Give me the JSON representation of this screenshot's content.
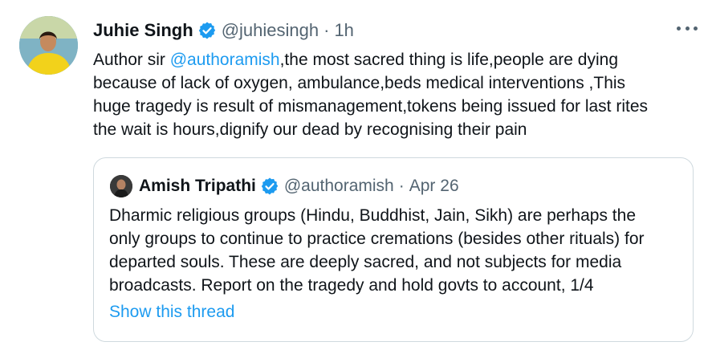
{
  "tweet": {
    "author_name": "Juhie Singh",
    "author_handle": "@juhiesingh",
    "separator": "·",
    "time": "1h",
    "more_label": "More",
    "text_lines": {
      "l1_prefix": "Author sir ",
      "l1_mention": "@authoramish",
      "l1_suffix": ",the most sacred thing is life,people are dying",
      "l2": "because of lack of oxygen, ambulance,beds medical interventions ,This",
      "l3": "huge tragedy is result of mismanagement,tokens  being issued for last rites",
      "l4": "the wait is hours,dignify our dead by recognising their pain"
    }
  },
  "quote": {
    "author_name": "Amish Tripathi",
    "author_handle": "@authoramish",
    "separator": "·",
    "date": "Apr 26",
    "text_lines": {
      "l1": "Dharmic religious groups (Hindu, Buddhist, Jain, Sikh) are perhaps the",
      "l2": "only groups to continue to practice cremations (besides other rituals) for",
      "l3": "departed souls. These are deeply sacred, and not subjects for media",
      "l4": "broadcasts. Report on the tragedy and hold govts to account, 1/4"
    },
    "show_thread": "Show this thread"
  },
  "icons": {
    "verified": "verified-badge-icon",
    "more": "more-dots-icon"
  },
  "colors": {
    "link": "#1d9bf0",
    "secondary_text": "#536471",
    "primary_text": "#0f1419",
    "border": "#cfd9de"
  }
}
